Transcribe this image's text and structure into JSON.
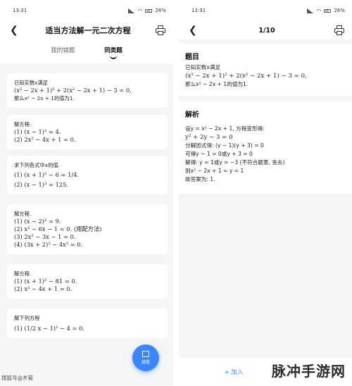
{
  "left": {
    "status": {
      "time": "13:31",
      "battery": "26%"
    },
    "nav": {
      "title": "适当方法解一元二次方程"
    },
    "tabs": [
      {
        "label": "我的错题"
      },
      {
        "label": "同类题"
      }
    ],
    "cards": [
      {
        "lines": [
          "已知实数x满足",
          "(x² − 2x + 1)² + 2(x² − 2x + 1) − 3 = 0,",
          "那么x² − 2x + 1的值为1."
        ]
      },
      {
        "lines": [
          "解方程:",
          "(1) (x − 1)² = 4.",
          "(2) 2x² − 4x + 1 = 0."
        ]
      },
      {
        "lines": [
          "求下列各式中x的值.",
          "(1) (x + 1)² − 6 = 1/4.",
          "(2) (x − 1)³ = 125."
        ]
      },
      {
        "lines": [
          "解方程.",
          "(1) (x − 2)² = 9.",
          "(2) x² − 6x − 1 = 0. (用配方法)",
          "(3) 2x² − 3x − 1 = 0.",
          "(4) (3x + 2)² − 4x² = 0."
        ]
      },
      {
        "lines": [
          "解方程.",
          "(1) (x + 1)² − 81 = 0.",
          "(2) x² − 4x + 1 = 0."
        ]
      },
      {
        "lines": [
          "解下列方程",
          "(1) (1/2 x − 1)² − 4 = 0."
        ]
      }
    ],
    "fab": {
      "label": "组卷"
    },
    "watermark": "搜狐号@木菊"
  },
  "right": {
    "status": {
      "time": "13:31",
      "battery": "26%"
    },
    "nav": {
      "page": "1/10"
    },
    "question": {
      "heading": "题目",
      "lines": [
        "已知实数x满足",
        "(x² − 2x + 1)² + 2(x² − 2x + 1) − 3 = 0,",
        "那么x² − 2x + 1的值为1."
      ]
    },
    "analysis": {
      "heading": "解析",
      "lines": [
        "设y = x² − 2x + 1, 方程变形得:",
        "y² + 2y − 3 = 0",
        "分解因式得: (y − 1)(y + 3) = 0",
        "可得y − 1 = 0或y + 3 = 0",
        "解得: y = 1或y = −3 (不符合题意, 舍去)",
        "则x² − 2x + 1 = y = 1",
        "故答案为: 1."
      ]
    },
    "add_button": "+ 加入",
    "watermark": {
      "text": "脉冲手游网"
    }
  }
}
